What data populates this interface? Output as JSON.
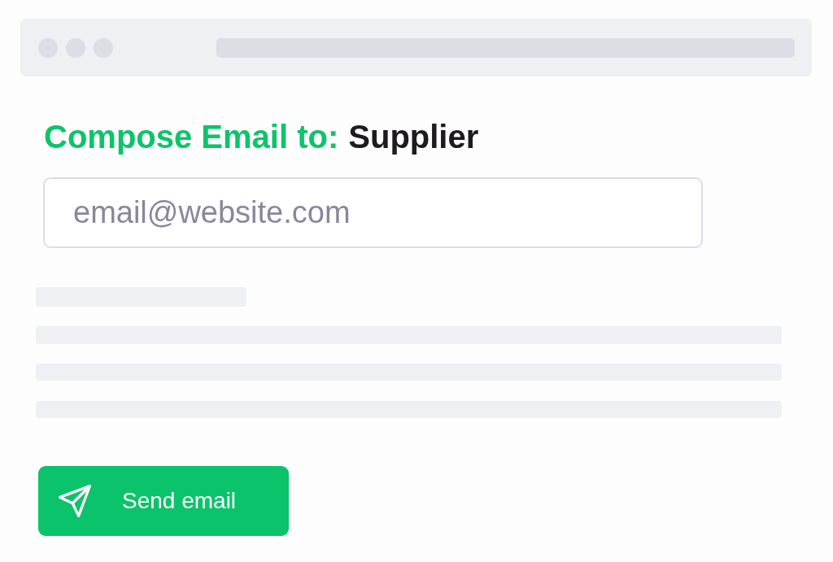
{
  "heading": {
    "label": "Compose Email to:",
    "recipient": "Supplier"
  },
  "email_field": {
    "placeholder": "email@website.com"
  },
  "send_button": {
    "label": "Send email"
  }
}
